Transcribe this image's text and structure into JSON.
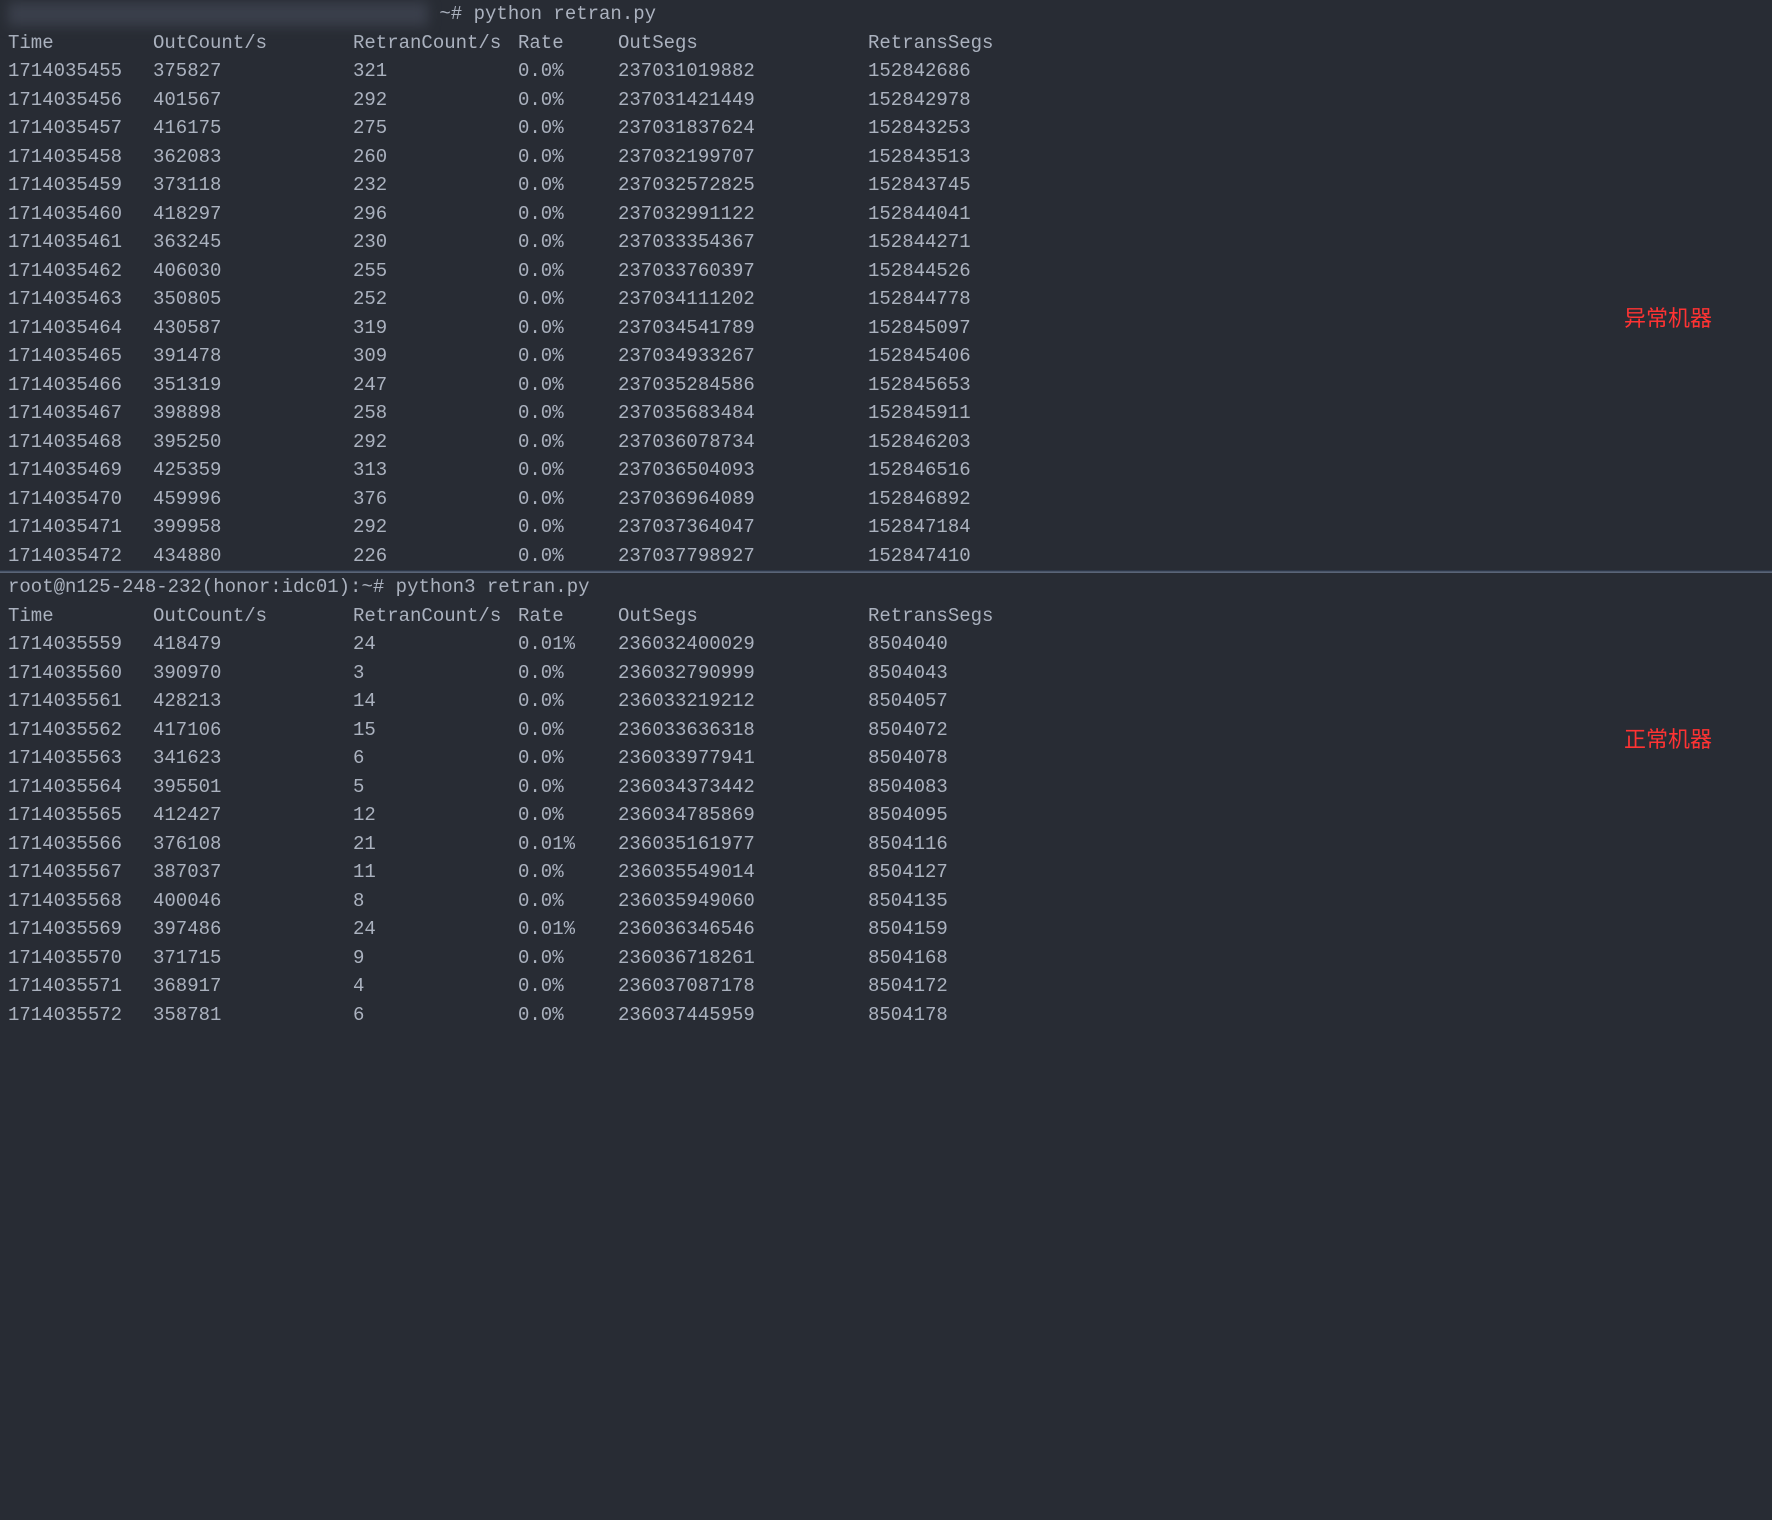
{
  "top_section": {
    "prompt_suffix": "~# python retran.py",
    "annotation": "异常机器",
    "headers": {
      "time": "Time",
      "outcount": "OutCount/s",
      "retran": "RetranCount/s",
      "rate": "Rate",
      "outsegs": "OutSegs",
      "retranssegs": "RetransSegs"
    },
    "rows": [
      {
        "time": "1714035455",
        "outcount": "375827",
        "retran": "321",
        "rate": "0.0%",
        "outsegs": "237031019882",
        "retranssegs": "152842686"
      },
      {
        "time": "1714035456",
        "outcount": "401567",
        "retran": "292",
        "rate": "0.0%",
        "outsegs": "237031421449",
        "retranssegs": "152842978"
      },
      {
        "time": "1714035457",
        "outcount": "416175",
        "retran": "275",
        "rate": "0.0%",
        "outsegs": "237031837624",
        "retranssegs": "152843253"
      },
      {
        "time": "1714035458",
        "outcount": "362083",
        "retran": "260",
        "rate": "0.0%",
        "outsegs": "237032199707",
        "retranssegs": "152843513"
      },
      {
        "time": "1714035459",
        "outcount": "373118",
        "retran": "232",
        "rate": "0.0%",
        "outsegs": "237032572825",
        "retranssegs": "152843745"
      },
      {
        "time": "1714035460",
        "outcount": "418297",
        "retran": "296",
        "rate": "0.0%",
        "outsegs": "237032991122",
        "retranssegs": "152844041"
      },
      {
        "time": "1714035461",
        "outcount": "363245",
        "retran": "230",
        "rate": "0.0%",
        "outsegs": "237033354367",
        "retranssegs": "152844271"
      },
      {
        "time": "1714035462",
        "outcount": "406030",
        "retran": "255",
        "rate": "0.0%",
        "outsegs": "237033760397",
        "retranssegs": "152844526"
      },
      {
        "time": "1714035463",
        "outcount": "350805",
        "retran": "252",
        "rate": "0.0%",
        "outsegs": "237034111202",
        "retranssegs": "152844778"
      },
      {
        "time": "1714035464",
        "outcount": "430587",
        "retran": "319",
        "rate": "0.0%",
        "outsegs": "237034541789",
        "retranssegs": "152845097"
      },
      {
        "time": "1714035465",
        "outcount": "391478",
        "retran": "309",
        "rate": "0.0%",
        "outsegs": "237034933267",
        "retranssegs": "152845406"
      },
      {
        "time": "1714035466",
        "outcount": "351319",
        "retran": "247",
        "rate": "0.0%",
        "outsegs": "237035284586",
        "retranssegs": "152845653"
      },
      {
        "time": "1714035467",
        "outcount": "398898",
        "retran": "258",
        "rate": "0.0%",
        "outsegs": "237035683484",
        "retranssegs": "152845911"
      },
      {
        "time": "1714035468",
        "outcount": "395250",
        "retran": "292",
        "rate": "0.0%",
        "outsegs": "237036078734",
        "retranssegs": "152846203"
      },
      {
        "time": "1714035469",
        "outcount": "425359",
        "retran": "313",
        "rate": "0.0%",
        "outsegs": "237036504093",
        "retranssegs": "152846516"
      },
      {
        "time": "1714035470",
        "outcount": "459996",
        "retran": "376",
        "rate": "0.0%",
        "outsegs": "237036964089",
        "retranssegs": "152846892"
      },
      {
        "time": "1714035471",
        "outcount": "399958",
        "retran": "292",
        "rate": "0.0%",
        "outsegs": "237037364047",
        "retranssegs": "152847184"
      },
      {
        "time": "1714035472",
        "outcount": "434880",
        "retran": "226",
        "rate": "0.0%",
        "outsegs": "237037798927",
        "retranssegs": "152847410"
      }
    ]
  },
  "bottom_section": {
    "prompt": "root@n125-248-232(honor:idc01):~# python3 retran.py",
    "annotation": "正常机器",
    "headers": {
      "time": "Time",
      "outcount": "OutCount/s",
      "retran": "RetranCount/s",
      "rate": "Rate",
      "outsegs": "OutSegs",
      "retranssegs": "RetransSegs"
    },
    "rows": [
      {
        "time": "1714035559",
        "outcount": "418479",
        "retran": "24",
        "rate": "0.01%",
        "outsegs": "236032400029",
        "retranssegs": "8504040"
      },
      {
        "time": "1714035560",
        "outcount": "390970",
        "retran": "3",
        "rate": "0.0%",
        "outsegs": "236032790999",
        "retranssegs": "8504043"
      },
      {
        "time": "1714035561",
        "outcount": "428213",
        "retran": "14",
        "rate": "0.0%",
        "outsegs": "236033219212",
        "retranssegs": "8504057"
      },
      {
        "time": "1714035562",
        "outcount": "417106",
        "retran": "15",
        "rate": "0.0%",
        "outsegs": "236033636318",
        "retranssegs": "8504072"
      },
      {
        "time": "1714035563",
        "outcount": "341623",
        "retran": "6",
        "rate": "0.0%",
        "outsegs": "236033977941",
        "retranssegs": "8504078"
      },
      {
        "time": "1714035564",
        "outcount": "395501",
        "retran": "5",
        "rate": "0.0%",
        "outsegs": "236034373442",
        "retranssegs": "8504083"
      },
      {
        "time": "1714035565",
        "outcount": "412427",
        "retran": "12",
        "rate": "0.0%",
        "outsegs": "236034785869",
        "retranssegs": "8504095"
      },
      {
        "time": "1714035566",
        "outcount": "376108",
        "retran": "21",
        "rate": "0.01%",
        "outsegs": "236035161977",
        "retranssegs": "8504116"
      },
      {
        "time": "1714035567",
        "outcount": "387037",
        "retran": "11",
        "rate": "0.0%",
        "outsegs": "236035549014",
        "retranssegs": "8504127"
      },
      {
        "time": "1714035568",
        "outcount": "400046",
        "retran": "8",
        "rate": "0.0%",
        "outsegs": "236035949060",
        "retranssegs": "8504135"
      },
      {
        "time": "1714035569",
        "outcount": "397486",
        "retran": "24",
        "rate": "0.01%",
        "outsegs": "236036346546",
        "retranssegs": "8504159"
      },
      {
        "time": "1714035570",
        "outcount": "371715",
        "retran": "9",
        "rate": "0.0%",
        "outsegs": "236036718261",
        "retranssegs": "8504168"
      },
      {
        "time": "1714035571",
        "outcount": "368917",
        "retran": "4",
        "rate": "0.0%",
        "outsegs": "236037087178",
        "retranssegs": "8504172"
      },
      {
        "time": "1714035572",
        "outcount": "358781",
        "retran": "6",
        "rate": "0.0%",
        "outsegs": "236037445959",
        "retranssegs": "8504178"
      }
    ]
  }
}
